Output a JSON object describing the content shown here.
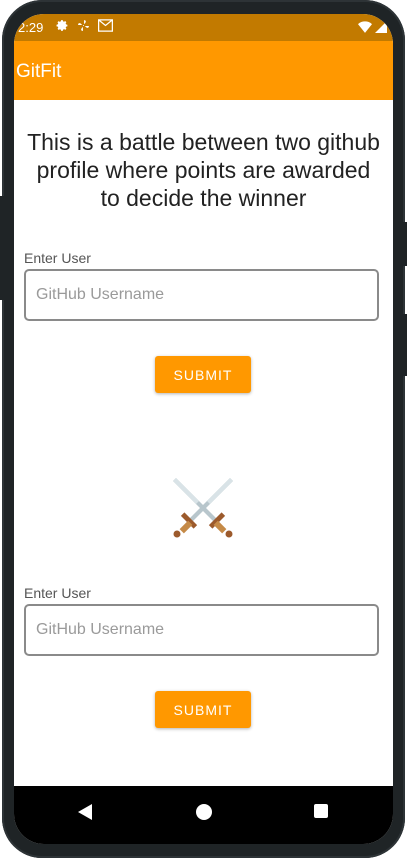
{
  "status": {
    "time": "2:29",
    "icons": [
      "gear-icon",
      "fan-icon",
      "mail-icon"
    ],
    "right_icons": [
      "wifi-icon",
      "signal-icon"
    ]
  },
  "appbar": {
    "title": "GitFit"
  },
  "intro": {
    "text": "This is a battle between two github profile where points are awarded to decide the winner"
  },
  "user1": {
    "label": "Enter User",
    "placeholder": "GitHub Username",
    "value": "",
    "submit_label": "SUBMIT"
  },
  "battle": {
    "icon": "crossed-swords-icon"
  },
  "user2": {
    "label": "Enter User",
    "placeholder": "GitHub Username",
    "value": "",
    "submit_label": "SUBMIT"
  },
  "nav": {
    "icons": [
      "back-icon",
      "home-icon",
      "recents-icon"
    ]
  },
  "colors": {
    "accent": "#ff9800",
    "status_bar": "#c27a00"
  }
}
